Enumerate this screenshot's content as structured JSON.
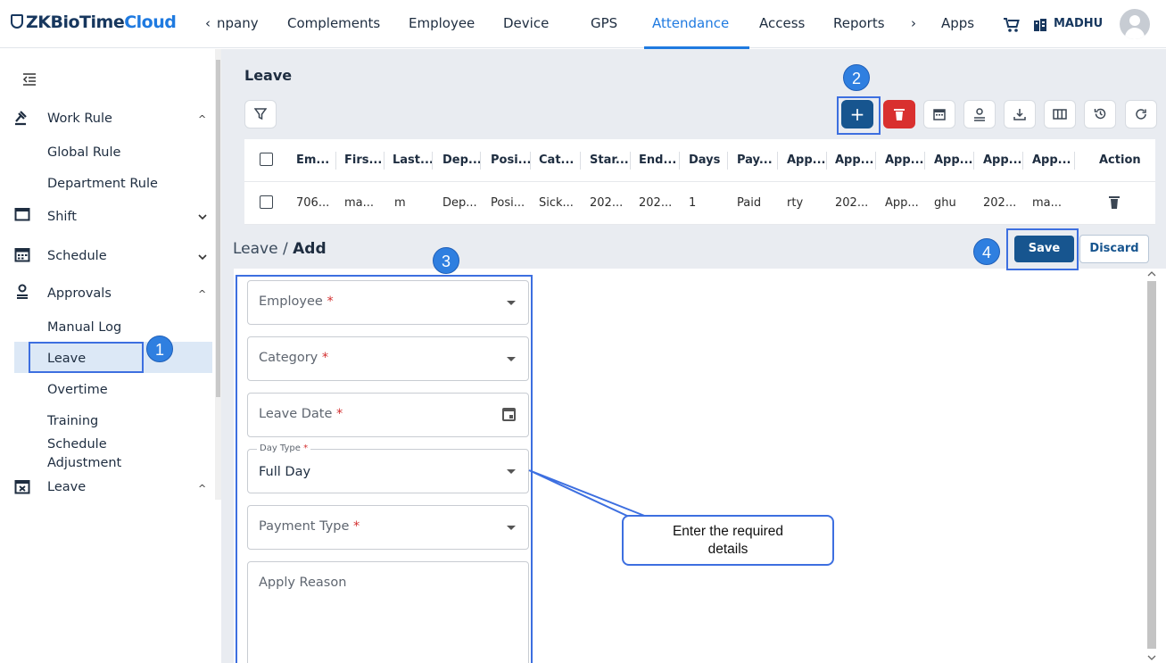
{
  "brand": {
    "part1": "ZKBioTime",
    "part2": "Cloud"
  },
  "nav": {
    "items": [
      "‹",
      "npany",
      "Complements",
      "Employee",
      "Device",
      "GPS",
      "Attendance",
      "Access",
      "Reports",
      "›",
      "Apps"
    ],
    "active": "Attendance",
    "user": "MADHU",
    "icons": [
      "cart-icon",
      "building-icon",
      "avatar-icon"
    ]
  },
  "sidebar": {
    "items": [
      {
        "label": "Work Rule",
        "icon": "gavel-icon",
        "state": "expanded"
      },
      {
        "label": "Global Rule",
        "sub": true
      },
      {
        "label": "Department Rule",
        "sub": true
      },
      {
        "label": "Shift",
        "icon": "calendar-icon",
        "state": "collapsed"
      },
      {
        "label": "Schedule",
        "icon": "calendar-grid-icon",
        "state": "collapsed"
      },
      {
        "label": "Approvals",
        "icon": "user-approve-icon",
        "state": "expanded"
      },
      {
        "label": "Manual Log",
        "sub": true
      },
      {
        "label": "Leave",
        "sub": true,
        "active": true
      },
      {
        "label": "Overtime",
        "sub": true
      },
      {
        "label": "Training",
        "sub": true
      },
      {
        "label": "Schedule Adjustment",
        "sub": true
      },
      {
        "label": "Leave",
        "icon": "calendar-x-icon",
        "state": "expanded"
      }
    ],
    "collapse_icon": "indent-icon"
  },
  "list": {
    "title": "Leave",
    "toolbar": [
      "filter-icon",
      "add-icon",
      "delete-icon",
      "calendar-icon",
      "approve-icon",
      "download-icon",
      "columns-icon",
      "history-icon",
      "refresh-icon"
    ],
    "columns": [
      "Em...",
      "Firs...",
      "Last...",
      "Dep...",
      "Posi...",
      "Cat...",
      "Star...",
      "End...",
      "Days",
      "Pay...",
      "App...",
      "App...",
      "App...",
      "App...",
      "App...",
      "App...",
      "Action"
    ],
    "rows": [
      [
        "706...",
        "ma...",
        "m",
        "Dep...",
        "Posi...",
        "Sick...",
        "202...",
        "202...",
        "1",
        "Paid",
        "rty",
        "202...",
        "App...",
        "ghu",
        "202...",
        "ma...",
        ""
      ]
    ]
  },
  "form": {
    "breadcrumb_root": "Leave",
    "breadcrumb_sep": "/",
    "breadcrumb_current": "Add",
    "save_label": "Save",
    "discard_label": "Discard",
    "required_mark": "*",
    "fields": {
      "employee": "Employee",
      "category": "Category",
      "leave_date": "Leave Date",
      "day_type_label": "Day Type",
      "day_type_value": "Full Day",
      "payment_type": "Payment Type",
      "apply_reason": "Apply Reason"
    }
  },
  "annotations": {
    "steps": [
      "1",
      "2",
      "3",
      "4"
    ],
    "callout_line1": "Enter the required",
    "callout_line2": "details",
    "highlight_color": "#3d6fe0",
    "badge_color": "#2f7fe0"
  },
  "colors": {
    "primary": "#17558f",
    "accent": "#1f7ae0",
    "danger": "#d9302f"
  }
}
